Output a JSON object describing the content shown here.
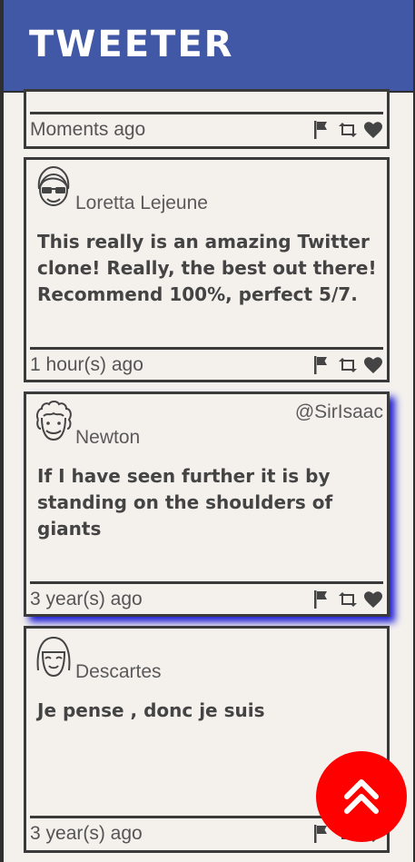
{
  "header": {
    "brand": "TWEETER",
    "color": "#4158a6"
  },
  "tweets": [
    {
      "author": "",
      "handle": "",
      "text": "",
      "time": "Moments ago"
    },
    {
      "author": "Loretta Lejeune",
      "handle": "",
      "text": "This really is an amazing Twitter clone! Really, the best out there! Recommend 100%, perfect 5/7.",
      "time": "1 hour(s) ago",
      "avatar": "avatar-sunglasses-icon"
    },
    {
      "author": "Newton",
      "handle": "@SirIsaac",
      "text": "If I have seen further it is by standing on the shoulders of giants",
      "time": "3 year(s) ago",
      "avatar": "avatar-curly-hair-icon"
    },
    {
      "author": "Descartes",
      "handle": "",
      "text": "Je pense , donc je suis",
      "time": "3 year(s) ago",
      "avatar": "avatar-bob-hair-icon"
    }
  ],
  "actions": [
    "flag-icon",
    "retweet-icon",
    "heart-icon"
  ],
  "fab": {
    "icon": "double-chevron-up-icon",
    "color": "#ff0000"
  }
}
